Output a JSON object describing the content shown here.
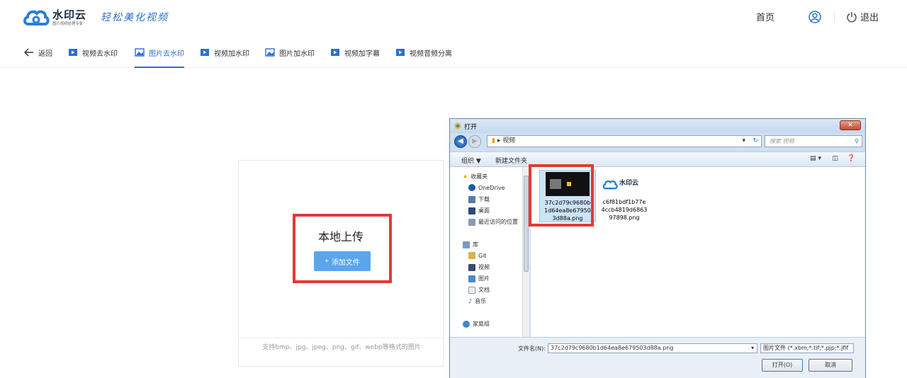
{
  "header": {
    "logo_name": "水印云",
    "logo_sub": "图片视频处理专家",
    "slogan": "轻松美化视频",
    "home": "首页",
    "logout": "退出"
  },
  "toolbar": {
    "back": "返回",
    "items": [
      {
        "label": "视频去水印",
        "icon": "video-icon"
      },
      {
        "label": "图片去水印",
        "icon": "image-icon",
        "active": true
      },
      {
        "label": "视频加水印",
        "icon": "video-icon"
      },
      {
        "label": "图片加水印",
        "icon": "image-icon"
      },
      {
        "label": "视频加字幕",
        "icon": "video-icon"
      },
      {
        "label": "视频音频分离",
        "icon": "video-icon"
      }
    ]
  },
  "upload": {
    "title": "本地上传",
    "button": "添加文件",
    "hint": "支持bmp、jpg、jpeg、png、gif、webp等格式的图片"
  },
  "dialog": {
    "title": "打开",
    "breadcrumb": "视频",
    "search_placeholder": "搜索 视频",
    "organize": "组织 ▼",
    "new_folder": "新建文件夹",
    "nav": {
      "favorites": "收藏夹",
      "onedrive": "OneDrive",
      "downloads": "下载",
      "desktop": "桌面",
      "recent": "最近访问的位置",
      "libraries": "库",
      "git": "Git",
      "videos": "视频",
      "pictures": "图片",
      "documents": "文档",
      "music": "音乐",
      "homegroup": "家庭组"
    },
    "files": [
      {
        "lines": [
          "37c2d79c9680b",
          "1d64ea8e67950",
          "3d88a.png"
        ],
        "selected": true
      },
      {
        "lines": [
          "c6f81bdf1b77e",
          "4ccb4819d6863",
          "97898.png"
        ],
        "selected": false
      }
    ],
    "thumb2_logo": "水印云",
    "filename_label": "文件名(N):",
    "filename_value": "37c2d79c9680b1d64ea8e679503d88a.png",
    "filetype_value": "图片文件 (*.xbm;*.tif;*.pjp;*.jfif",
    "open_button": "打开(O)",
    "cancel_button": "取消"
  },
  "colors": {
    "accent": "#2a6fd0",
    "button": "#5aa5ee",
    "highlight": "#e53935"
  }
}
